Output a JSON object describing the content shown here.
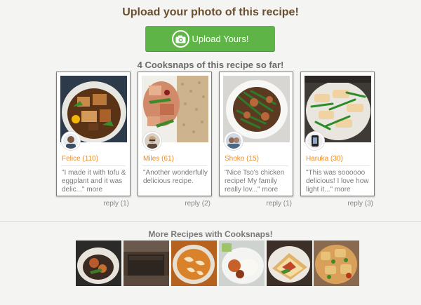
{
  "header": {
    "title": "Upload your photo of this recipe!",
    "upload_label": "Upload Yours!",
    "cooksnaps_title": "4 Cooksnaps of this recipe so far!"
  },
  "cooksnaps": [
    {
      "user": "Felice (110)",
      "comment": "\"I made it with tofu & eggplant and it was delic...\"",
      "more": "more",
      "reply": "reply (1)"
    },
    {
      "user": "Miles (61)",
      "comment": "\"Another wonderfully delicious recipe.",
      "more": "",
      "reply": "reply (2)"
    },
    {
      "user": "Shoko (15)",
      "comment": "\"Nice Tso's chicken recipe! My family really lov...\"",
      "more": "more",
      "reply": "reply (1)"
    },
    {
      "user": "Haruka (30)",
      "comment": "\"This was soooooo delicious! I love how light it...\"",
      "more": "more",
      "reply": "reply (3)"
    }
  ],
  "more_recipes": {
    "title": "More Recipes with Cooksnaps!"
  },
  "colors": {
    "accent_green": "#5fb447",
    "username_orange": "#f08a1d",
    "headline_brown": "#6b4e2e"
  }
}
